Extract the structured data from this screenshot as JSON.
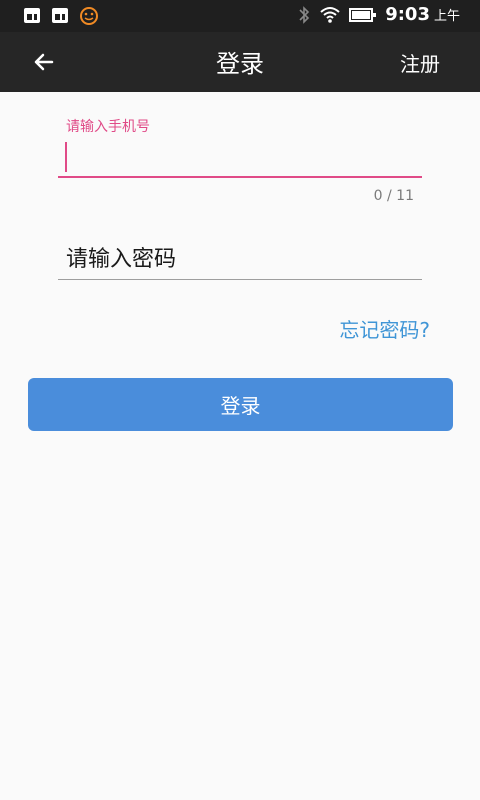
{
  "status_bar": {
    "icons": [
      "sd-card-icon",
      "sd-card-icon",
      "smiley-icon",
      "bluetooth-icon",
      "wifi-icon",
      "battery-icon"
    ],
    "time": "9:03",
    "ampm": "上午"
  },
  "app_bar": {
    "title": "登录",
    "register": "注册",
    "back_icon": "back-arrow-icon"
  },
  "form": {
    "phone_label": "请输入手机号",
    "phone_value": "",
    "phone_counter": "0 / 11",
    "password_placeholder": "请输入密码",
    "password_value": "",
    "forgot": "忘记密码?",
    "submit": "登录"
  },
  "colors": {
    "accent_pink": "#e04a87",
    "button_blue": "#4a8ddb",
    "link_blue": "#3f95d6",
    "bar_dark": "#262626"
  }
}
